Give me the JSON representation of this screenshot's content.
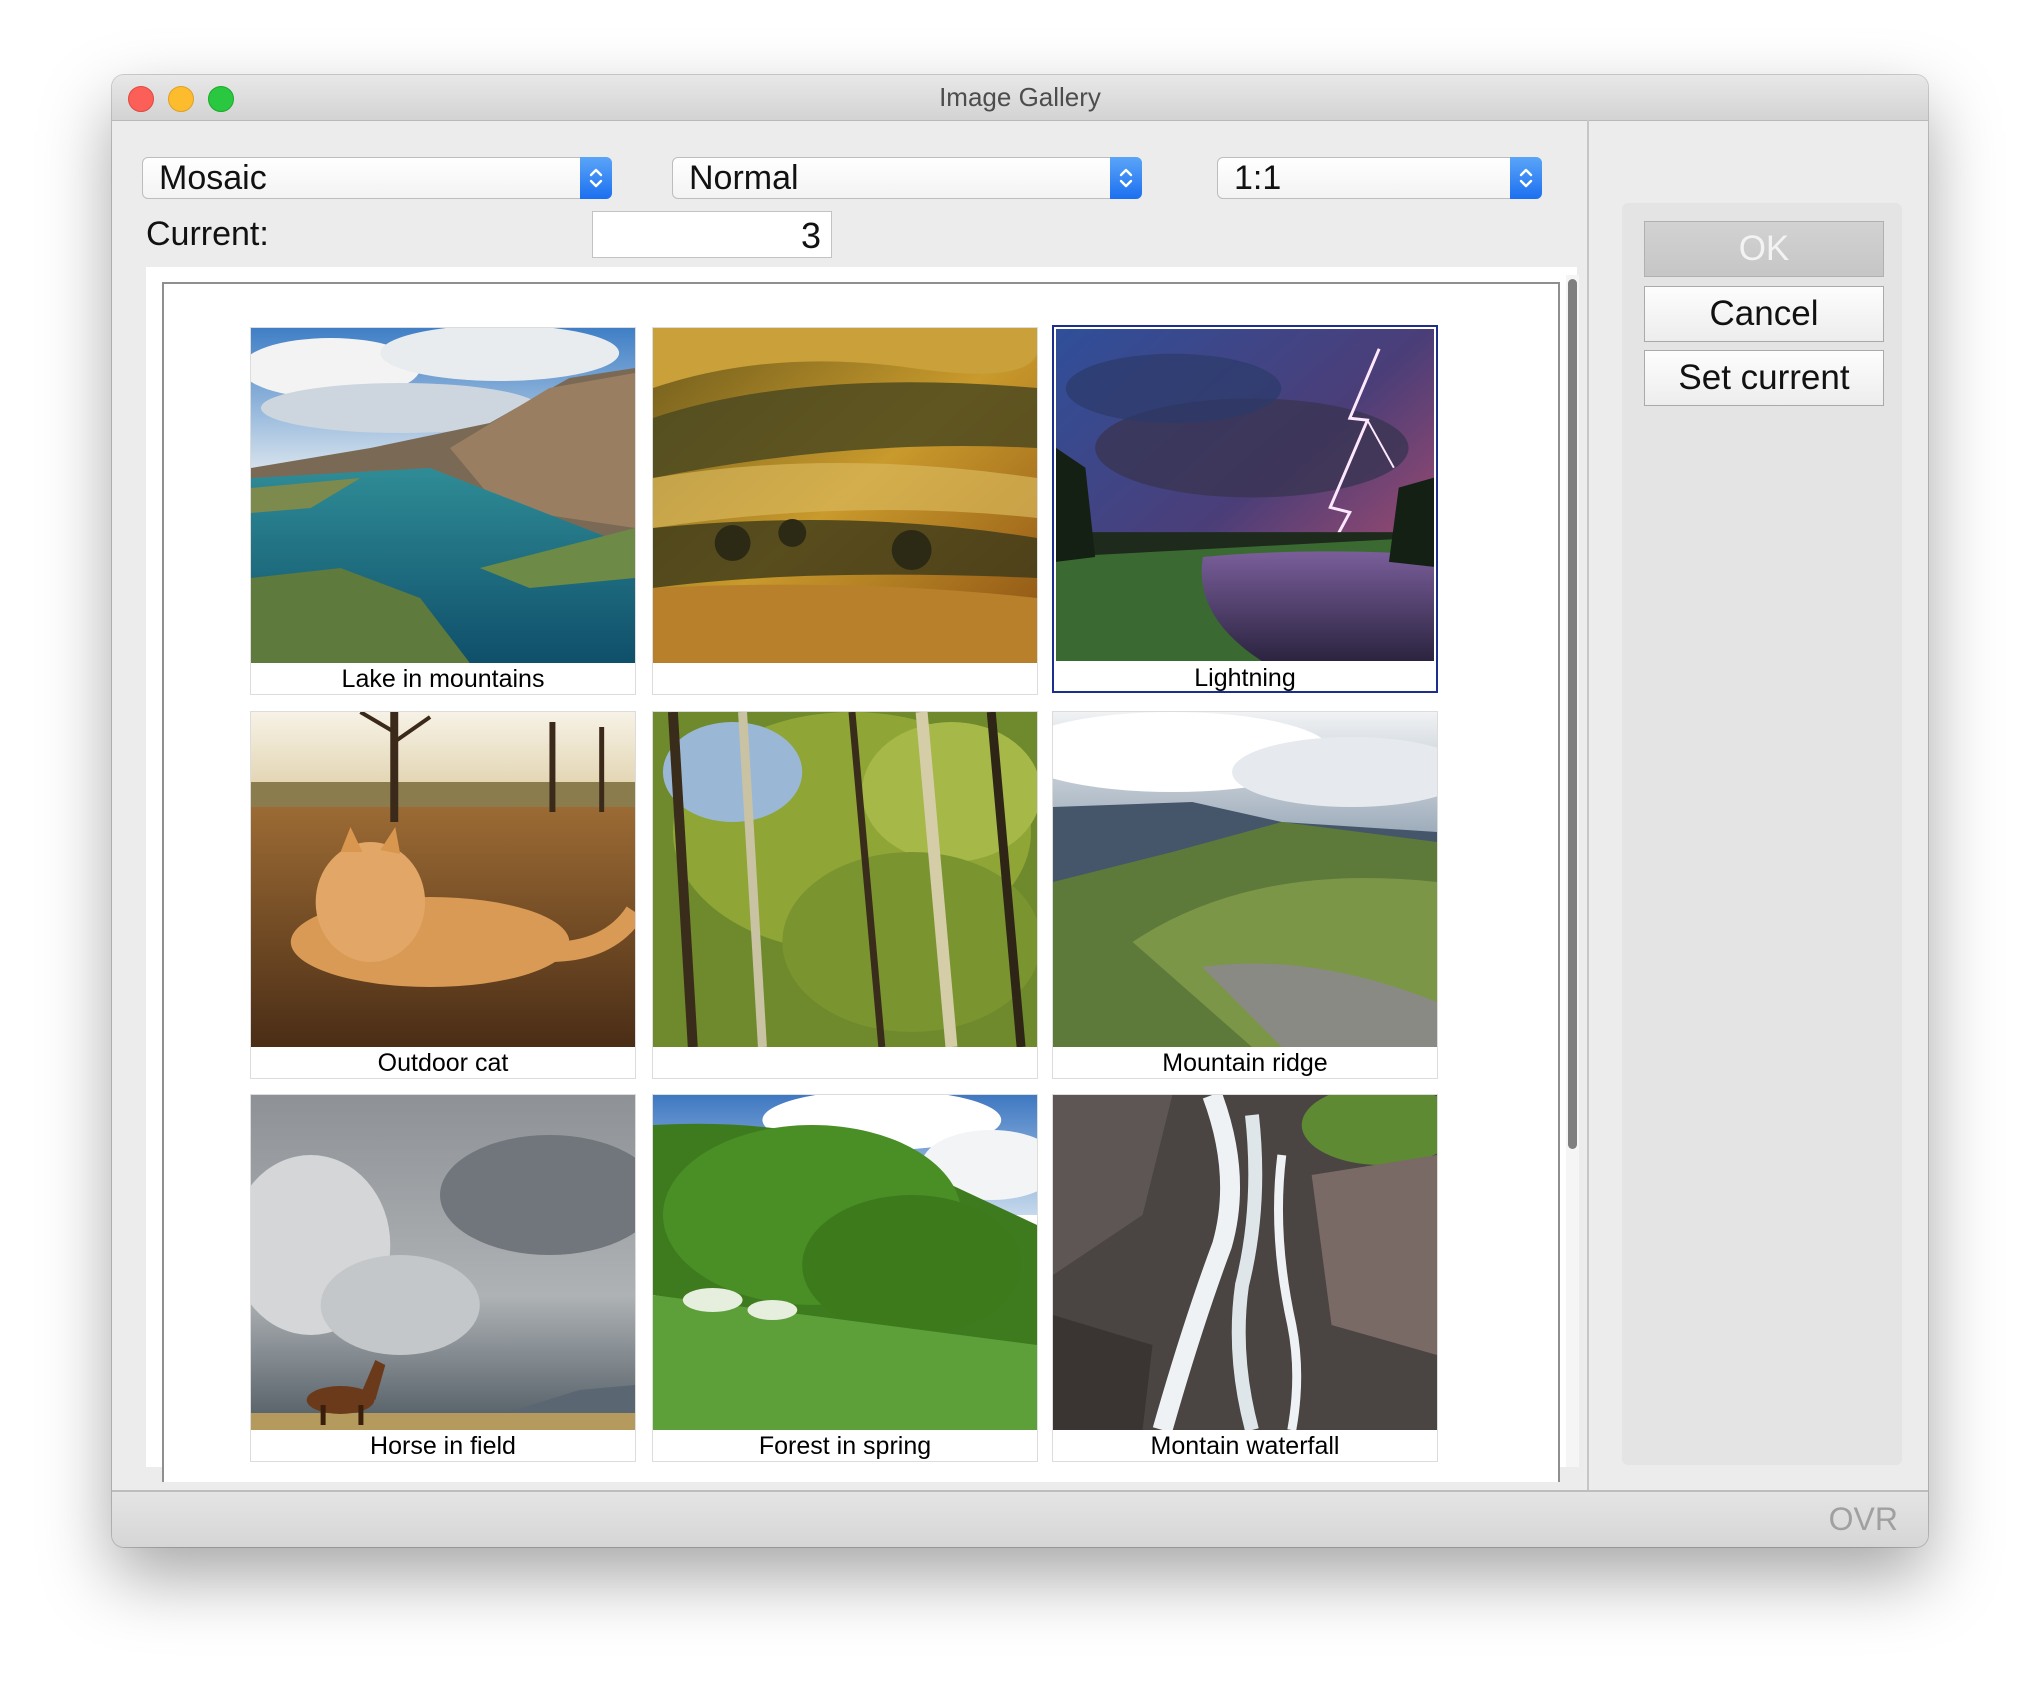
{
  "window": {
    "title": "Image Gallery"
  },
  "toolbar": {
    "layout_select": "Mosaic",
    "mode_select": "Normal",
    "ratio_select": "1:1",
    "current_label": "Current:",
    "current_value": "3"
  },
  "gallery": {
    "items": [
      {
        "caption": "Lake in mountains",
        "scene": "lake-mountains"
      },
      {
        "caption": "",
        "scene": "golden-hills"
      },
      {
        "caption": "Lightning",
        "scene": "lightning",
        "selected": true
      },
      {
        "caption": "Outdoor cat",
        "scene": "cat"
      },
      {
        "caption": "",
        "scene": "forest-trees"
      },
      {
        "caption": "Mountain ridge",
        "scene": "mountain-ridge"
      },
      {
        "caption": "Horse in field",
        "scene": "horse"
      },
      {
        "caption": "Forest in spring",
        "scene": "forest-spring"
      },
      {
        "caption": "Montain waterfall",
        "scene": "waterfall"
      }
    ]
  },
  "buttons": {
    "ok": "OK",
    "cancel": "Cancel",
    "set_current": "Set current"
  },
  "status": {
    "ovr": "OVR"
  },
  "colors": {
    "accent": "#1c6ff0",
    "selection": "#1c2f8c"
  }
}
